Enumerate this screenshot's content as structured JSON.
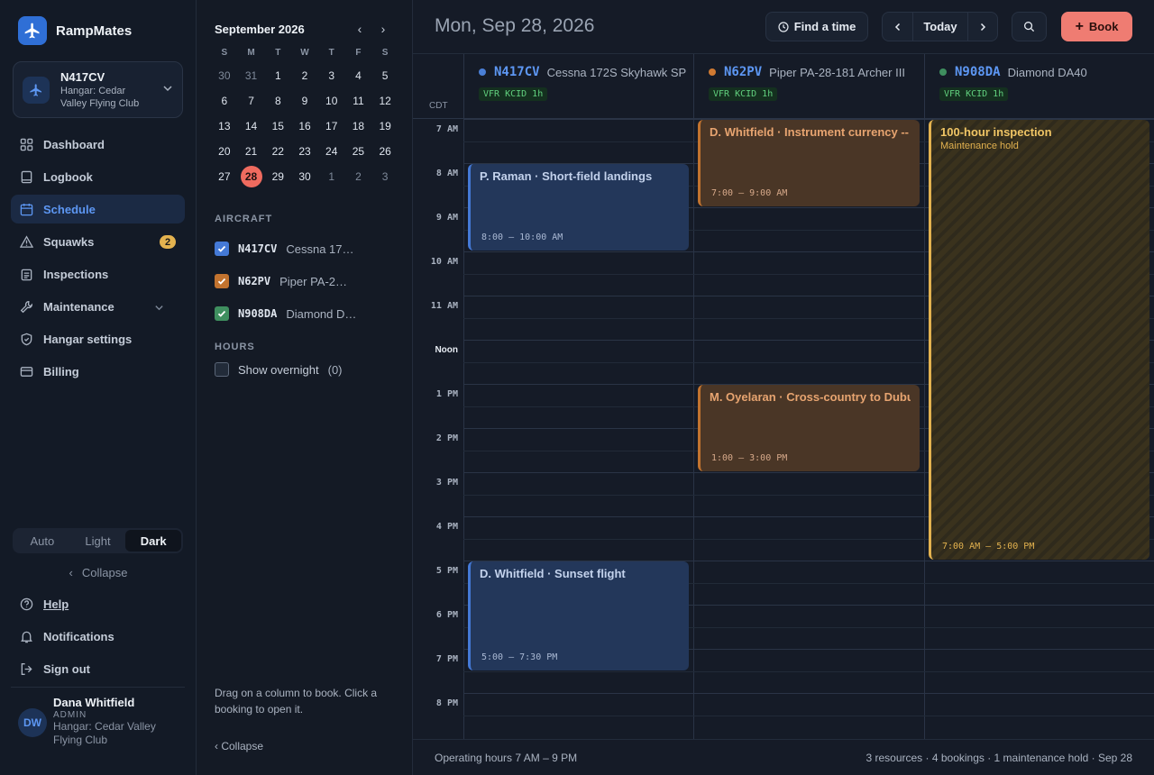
{
  "brand": {
    "name": "RampMates"
  },
  "aircraft_card": {
    "tail": "N417CV",
    "hangar_line1": "Hangar: Cedar",
    "hangar_line2": "Valley Flying Club"
  },
  "nav": {
    "dashboard": "Dashboard",
    "logbook": "Logbook",
    "schedule": "Schedule",
    "squawks": "Squawks",
    "squawks_count": "2",
    "inspections": "Inspections",
    "maintenance": "Maintenance",
    "hangar_settings": "Hangar settings",
    "billing": "Billing"
  },
  "theme": {
    "options": [
      "Auto",
      "Light",
      "Dark"
    ],
    "selected": "Dark"
  },
  "sidebar_collapse": "Collapse",
  "bottom_nav": {
    "help": "Help",
    "notifications": "Notifications",
    "sign_out": "Sign out"
  },
  "user": {
    "initials": "DW",
    "name": "Dana Whitfield",
    "role": "ADMIN",
    "hangar": "Hangar: Cedar Valley Flying Club"
  },
  "calendar": {
    "month_title": "September 2026",
    "dow": [
      "S",
      "M",
      "T",
      "W",
      "T",
      "F",
      "S"
    ],
    "weeks": [
      [
        "30",
        "31",
        "1",
        "2",
        "3",
        "4",
        "5"
      ],
      [
        "6",
        "7",
        "8",
        "9",
        "10",
        "11",
        "12"
      ],
      [
        "13",
        "14",
        "15",
        "16",
        "17",
        "18",
        "19"
      ],
      [
        "20",
        "21",
        "22",
        "23",
        "24",
        "25",
        "26"
      ],
      [
        "27",
        "28",
        "29",
        "30",
        "1",
        "2",
        "3"
      ]
    ],
    "selected_day": "28"
  },
  "aircraft_section": {
    "label": "AIRCRAFT",
    "items": [
      {
        "tail": "N417CV",
        "model": "Cessna 172S Skyhawk SP",
        "color": "#4479d6",
        "checked": true
      },
      {
        "tail": "N62PV",
        "model": "Piper PA-28-181 Archer III",
        "color": "#c2732f",
        "checked": true
      },
      {
        "tail": "N908DA",
        "model": "Diamond DA40",
        "color": "#3f8f5f",
        "checked": true
      }
    ]
  },
  "hours_section": {
    "label": "HOURS",
    "overnight_label": "Show overnight",
    "overnight_count": "(0)"
  },
  "hint": "Drag on a column to book. Click a booking to open it.",
  "mid_collapse": "‹ Collapse",
  "topbar": {
    "date_title": "Mon, Sep 28, 2026",
    "find_time": "Find a time",
    "today": "Today",
    "book": "Book"
  },
  "timezone": "CDT",
  "resources": [
    {
      "tail": "N417CV",
      "model": "Cessna 172S Skyhawk SP",
      "color": "#4a7fd6",
      "wx": "VFR KCID 1h"
    },
    {
      "tail": "N62PV",
      "model": "Piper PA-28-181 Archer III",
      "color": "#d07a32",
      "wx": "VFR KCID 1h"
    },
    {
      "tail": "N908DA",
      "model": "Diamond DA40",
      "color": "#3f8f5f",
      "wx": "VFR KCID 1h"
    }
  ],
  "hour_labels": [
    "7 AM",
    "8 AM",
    "9 AM",
    "10 AM",
    "11 AM",
    "Noon",
    "1 PM",
    "2 PM",
    "3 PM",
    "4 PM",
    "5 PM",
    "6 PM",
    "7 PM",
    "8 PM"
  ],
  "bookings": [
    {
      "col": 0,
      "title": "P. Raman · Short-field landings",
      "time": "8:00 – 10:00 AM",
      "start": 8,
      "end": 10,
      "kind": "blue"
    },
    {
      "col": 0,
      "title": "D. Whitfield · Sunset flight",
      "time": "5:00 – 7:30 PM",
      "start": 17,
      "end": 19.5,
      "kind": "blue"
    },
    {
      "col": 1,
      "title": "D. Whitfield · Instrument currency -- approaches",
      "time": "7:00 – 9:00 AM",
      "start": 7,
      "end": 9,
      "kind": "orange"
    },
    {
      "col": 1,
      "title": "M. Oyelaran · Cross-country to Dubuque",
      "time": "1:00 – 3:00 PM",
      "start": 13,
      "end": 15,
      "kind": "orange"
    },
    {
      "col": 2,
      "title": "100-hour inspection",
      "subtitle": "Maintenance hold",
      "time": "7:00 AM – 5:00 PM",
      "start": 7,
      "end": 17,
      "kind": "maint"
    }
  ],
  "footer": {
    "left": "Operating hours 7 AM – 9 PM",
    "right": "3 resources · 4 bookings · 1 maintenance hold · Sep 28"
  }
}
